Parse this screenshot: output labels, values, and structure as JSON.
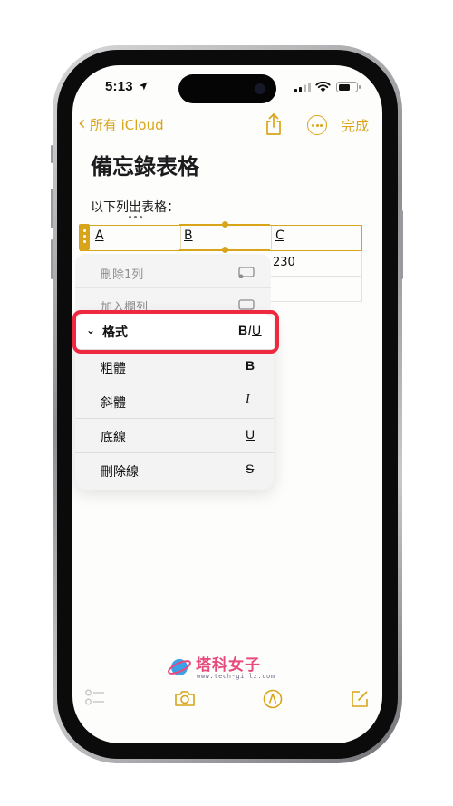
{
  "status_bar": {
    "time": "5:13"
  },
  "nav": {
    "back_label": "所有 iCloud",
    "done_label": "完成"
  },
  "note": {
    "title": "備忘錄表格",
    "body_text": "以下列出表格：",
    "table": {
      "header_cells": [
        "A",
        "B",
        "C"
      ],
      "row2_value": "230"
    }
  },
  "row_menu": {
    "items": [
      "刪除1列",
      "加入欄列"
    ]
  },
  "format_menu": {
    "header_label": "格式",
    "header_bold": "B",
    "header_italic": "I",
    "header_underline": "U",
    "items": [
      {
        "label": "粗體",
        "icon": "B"
      },
      {
        "label": "斜體",
        "icon": "I"
      },
      {
        "label": "底線",
        "icon": "U"
      },
      {
        "label": "刪除線",
        "icon": "S"
      }
    ]
  },
  "watermark": {
    "title": "塔科女子",
    "url": "www.tech-girlz.com"
  },
  "colors": {
    "accent": "#d8a51a",
    "highlight": "#ef2840"
  }
}
